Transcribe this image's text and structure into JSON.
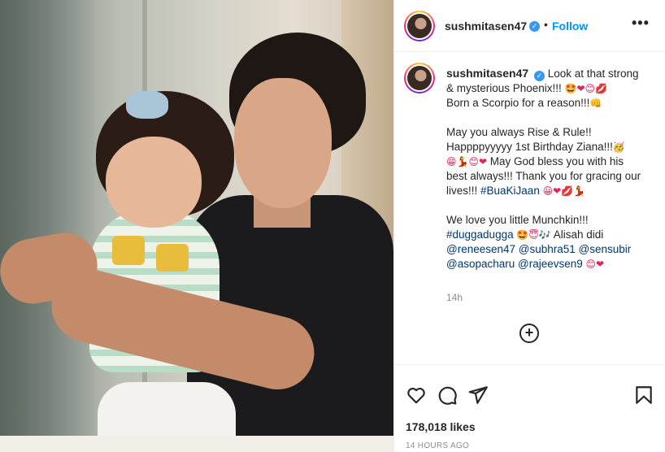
{
  "header": {
    "username": "sushmitasen47",
    "separator": "•",
    "follow_label": "Follow",
    "more_label": "•••"
  },
  "caption": {
    "username": "sushmitasen47",
    "p1": "Look at that strong & mysterious Phoenix!!! ",
    "p1_emojis": "🤩❤😊💋",
    "p1b": "Born a Scorpio for a reason!!!",
    "p1b_emoji": "👊",
    "p2a": "May you always Rise & Rule!! Happppyyyyy 1st Birthday Ziana!!!",
    "p2a_emoji": "🥳",
    "p2b_emojis": "😁💃😊❤",
    "p2b": " May God bless you with his best always!!! Thank you for gracing our lives!!! ",
    "p2_tag": "#BuaKiJaan",
    "p2c_emojis": "😀❤💋💃",
    "p3a": "We love you little Munchkin!!!",
    "p3_tag": "#duggadugga",
    "p3_emojis": "🤩😇🎶",
    "p3b": " Alisah didi ",
    "mention1": "@reneesen47",
    "mention2": "@subhra51",
    "mention3": "@sensubir",
    "mention4": "@asopacharu",
    "mention5": "@rajeevsen9",
    "p3c_emojis": "😊❤",
    "time_ago": "14h"
  },
  "load_more": "+",
  "footer": {
    "likes": "178,018 likes",
    "timestamp": "14 HOURS AGO"
  },
  "icons": {
    "like": "heart-icon",
    "comment": "comment-icon",
    "share": "share-icon",
    "save": "bookmark-icon",
    "verified": "verified-badge-icon",
    "more": "more-options-icon"
  },
  "colors": {
    "link": "#0095f6",
    "hashtag": "#00376b",
    "muted": "#8e8e8e",
    "verified": "#3897f0"
  }
}
